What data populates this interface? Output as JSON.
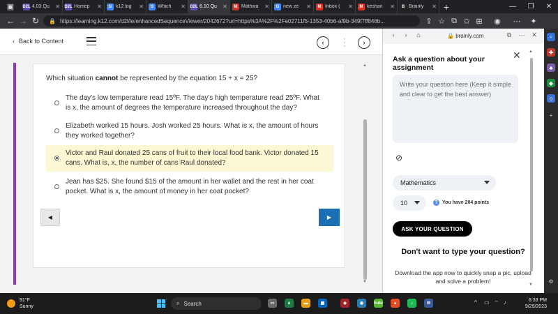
{
  "browser": {
    "tabs": [
      {
        "label": "4.03 Qu",
        "fav": "D2L",
        "color": "#5a4ba8"
      },
      {
        "label": "Homep",
        "fav": "D2L",
        "color": "#5a4ba8"
      },
      {
        "label": "k12 log",
        "fav": "G",
        "color": "#4285f4"
      },
      {
        "label": "Which",
        "fav": "G",
        "color": "#4285f4"
      },
      {
        "label": "6.10 Qu",
        "fav": "D2L",
        "color": "#5a4ba8"
      },
      {
        "label": "Mathwa",
        "fav": "M",
        "color": "#c0392b"
      },
      {
        "label": "new ze",
        "fav": "G",
        "color": "#4285f4"
      },
      {
        "label": "Inbox (",
        "fav": "M",
        "color": "#d93025"
      },
      {
        "label": "keshan",
        "fav": "M",
        "color": "#d93025"
      },
      {
        "label": "Brainly",
        "fav": "B",
        "color": "#222"
      }
    ],
    "active_tab_index": 4,
    "url": "https://learning.k12.com/d2l/le/enhancedSequenceViewer/2042672?url=https%3A%2F%2Fe02711f5-1353-40b6-af9b-349f7ff846b..."
  },
  "nav": {
    "back_label": "Back to Content"
  },
  "quiz": {
    "question_prefix": "Which situation ",
    "question_bold": "cannot",
    "question_suffix": " be represented by the equation 15 + x = 25?",
    "options": [
      {
        "text": "The day's low temperature read 15ºF.  The day's high temperature read 25ºF. What is x, the amount of degrees the temperature increased throughout the day?",
        "selected": false
      },
      {
        "text": "Elizabeth worked 15 hours. Josh worked 25 hours. What is x, the amount of hours they worked together?",
        "selected": false
      },
      {
        "text": "Victor and Raul donated 25 cans of fruit to their local food bank. Victor donated 15 cans. What is, x, the number of cans Raul donated?",
        "selected": true
      },
      {
        "text": "Jean has $25. She found $15 of the amount in her wallet and the rest in her coat pocket. What is x, the amount of money in her coat pocket?",
        "selected": false
      }
    ]
  },
  "brainly": {
    "domain": "brainly.com",
    "title": "Ask a question about your assignment",
    "placeholder": "Write your question here (Keep it simple and clear to get the best answer)",
    "subject": "Mathematics",
    "points": "10",
    "points_info": "You have 204 points",
    "ask_button": "ASK YOUR QUESTION",
    "promo_title": "Don't want to type your question?",
    "promo_text": "Download the app now to quickly snap a pic, upload and solve a problem!"
  },
  "taskbar": {
    "temp": "91°F",
    "weather": "Sunny",
    "search": "Search",
    "time": "6:33 PM",
    "date": "9/29/2023"
  },
  "colors": {
    "accent_purple": "#8b3db8",
    "next_blue": "#1a6fb5",
    "selected_bg": "#fbf8d3"
  }
}
